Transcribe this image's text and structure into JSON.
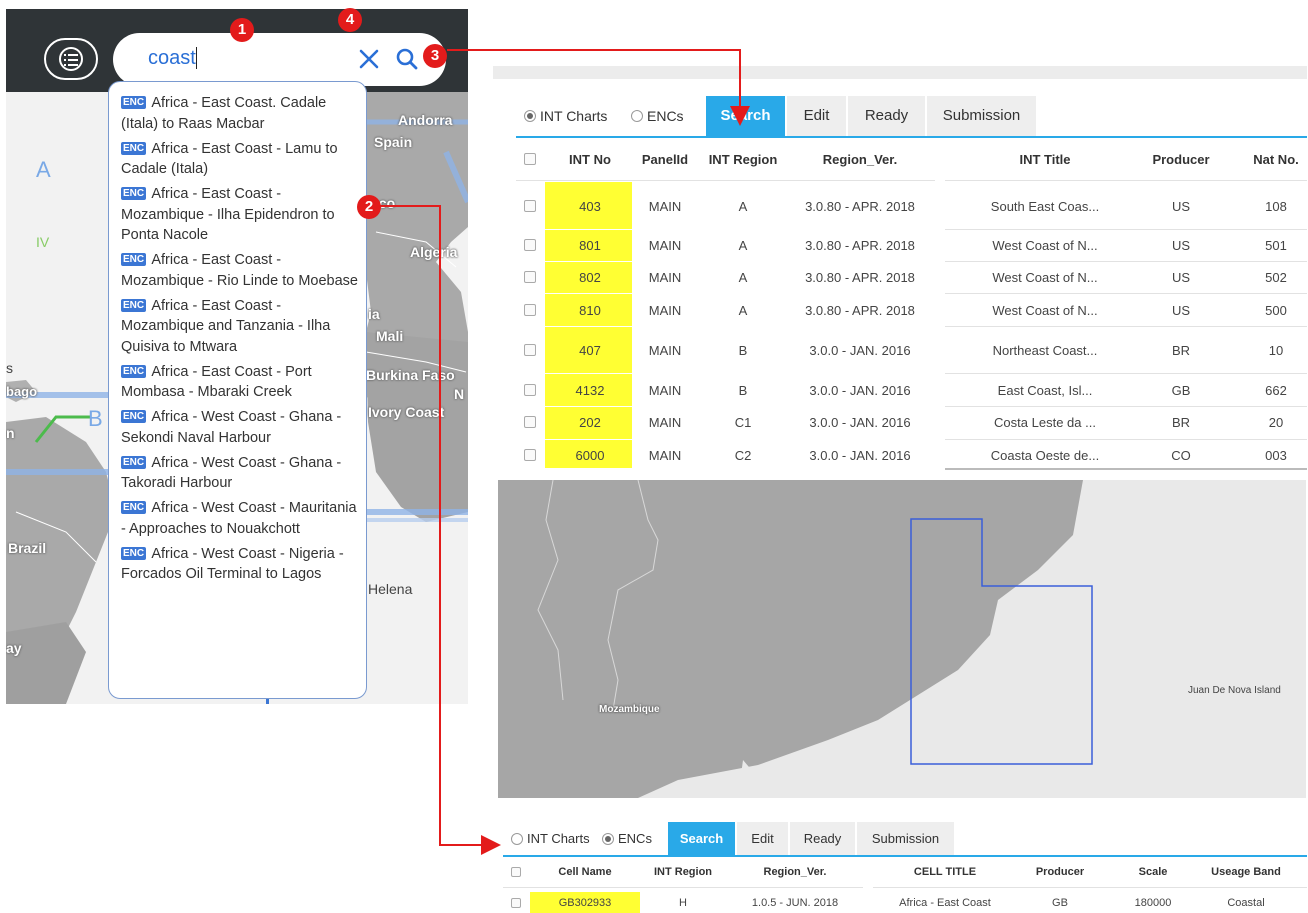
{
  "search": {
    "query": "coast",
    "suggestion_tag": "ENC",
    "suggestions": [
      "Africa - East Coast. Cadale (Itala) to Raas Macbar",
      "Africa - East Coast - Lamu to Cadale (Itala)",
      "Africa - East Coast - Mozambique - Ilha Epidendron to Ponta Nacole",
      "Africa - East Coast - Mozambique - Rio Linde to Moebase",
      "Africa - East Coast - Mozambique and Tanzania - Ilha Quisiva to Mtwara",
      "Africa - East Coast - Port Mombasa - Mbaraki Creek",
      "Africa - West Coast - Ghana - Sekondi Naval Harbour",
      "Africa - West Coast - Ghana - Takoradi Harbour",
      "Africa - West Coast - Mauritania - Approaches to Nouakchott",
      "Africa - West Coast - Nigeria - Forcados Oil Terminal to Lagos"
    ]
  },
  "badges": [
    "1",
    "2",
    "3",
    "4"
  ],
  "left_map": {
    "labels": [
      "Andorra",
      "Spain",
      "A",
      "IV",
      "Algeria",
      "Mali",
      "Burkina Faso",
      "Ivory Coast",
      "N",
      "Brazil",
      "Helena",
      "B",
      "s",
      "bago",
      "ay",
      "cco",
      "ia",
      "n"
    ]
  },
  "int_panel": {
    "radio_int": "INT Charts",
    "radio_enc": "ENCs",
    "tabs": [
      "Search",
      "Edit",
      "Ready",
      "Submission"
    ],
    "columns": [
      "INT No",
      "PanelId",
      "INT Region",
      "Region_Ver.",
      "INT Title",
      "Producer",
      "Nat No."
    ],
    "rows": [
      [
        "403",
        "MAIN",
        "A",
        "3.0.80 - APR. 2018",
        "South East Coas...",
        "US",
        "108"
      ],
      [
        "801",
        "MAIN",
        "A",
        "3.0.80 - APR. 2018",
        "West Coast of N...",
        "US",
        "501"
      ],
      [
        "802",
        "MAIN",
        "A",
        "3.0.80 - APR. 2018",
        "West Coast of N...",
        "US",
        "502"
      ],
      [
        "810",
        "MAIN",
        "A",
        "3.0.80 - APR. 2018",
        "West Coast of N...",
        "US",
        "500"
      ],
      [
        "407",
        "MAIN",
        "B",
        "3.0.0 - JAN. 2016",
        "Northeast Coast...",
        "BR",
        "10"
      ],
      [
        "4132",
        "MAIN",
        "B",
        "3.0.0 - JAN. 2016",
        "East Coast, Isl...",
        "GB",
        "662"
      ],
      [
        "202",
        "MAIN",
        "C1",
        "3.0.0 - JAN. 2016",
        "Costa Leste da ...",
        "BR",
        "20"
      ],
      [
        "6000",
        "MAIN",
        "C2",
        "3.0.0 - JAN. 2016",
        "Coasta Oeste de...",
        "CO",
        "003"
      ]
    ]
  },
  "right_map": {
    "label_mozambique": "Mozambique",
    "label_island": "Juan De Nova Island"
  },
  "enc_panel": {
    "radio_int": "INT Charts",
    "radio_enc": "ENCs",
    "tabs": [
      "Search",
      "Edit",
      "Ready",
      "Submission"
    ],
    "columns": [
      "Cell Name",
      "INT Region",
      "Region_Ver.",
      "CELL TITLE",
      "Producer",
      "Scale",
      "Useage Band"
    ],
    "rows": [
      [
        "GB302933",
        "H",
        "1.0.5 - JUN. 2018",
        "Africa - East Coast",
        "GB",
        "180000",
        "Coastal"
      ]
    ]
  },
  "colors": {
    "accent": "#29a9e8",
    "highlight": "#ffff33",
    "badge": "#e31b1b",
    "link": "#2a6fd6"
  }
}
